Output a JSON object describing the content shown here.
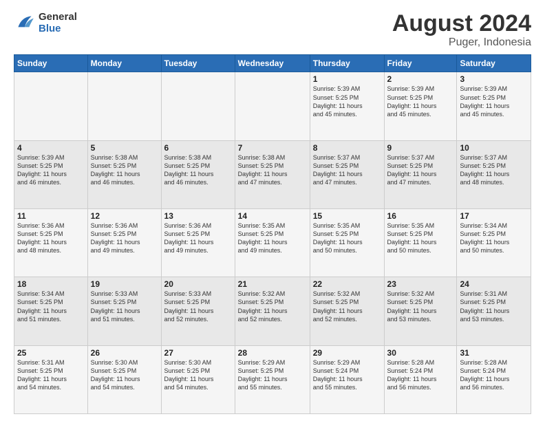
{
  "logo": {
    "line1": "General",
    "line2": "Blue"
  },
  "title": "August 2024",
  "subtitle": "Puger, Indonesia",
  "days_header": [
    "Sunday",
    "Monday",
    "Tuesday",
    "Wednesday",
    "Thursday",
    "Friday",
    "Saturday"
  ],
  "weeks": [
    [
      {
        "day": "",
        "info": ""
      },
      {
        "day": "",
        "info": ""
      },
      {
        "day": "",
        "info": ""
      },
      {
        "day": "",
        "info": ""
      },
      {
        "day": "1",
        "info": "Sunrise: 5:39 AM\nSunset: 5:25 PM\nDaylight: 11 hours\nand 45 minutes."
      },
      {
        "day": "2",
        "info": "Sunrise: 5:39 AM\nSunset: 5:25 PM\nDaylight: 11 hours\nand 45 minutes."
      },
      {
        "day": "3",
        "info": "Sunrise: 5:39 AM\nSunset: 5:25 PM\nDaylight: 11 hours\nand 45 minutes."
      }
    ],
    [
      {
        "day": "4",
        "info": "Sunrise: 5:39 AM\nSunset: 5:25 PM\nDaylight: 11 hours\nand 46 minutes."
      },
      {
        "day": "5",
        "info": "Sunrise: 5:38 AM\nSunset: 5:25 PM\nDaylight: 11 hours\nand 46 minutes."
      },
      {
        "day": "6",
        "info": "Sunrise: 5:38 AM\nSunset: 5:25 PM\nDaylight: 11 hours\nand 46 minutes."
      },
      {
        "day": "7",
        "info": "Sunrise: 5:38 AM\nSunset: 5:25 PM\nDaylight: 11 hours\nand 47 minutes."
      },
      {
        "day": "8",
        "info": "Sunrise: 5:37 AM\nSunset: 5:25 PM\nDaylight: 11 hours\nand 47 minutes."
      },
      {
        "day": "9",
        "info": "Sunrise: 5:37 AM\nSunset: 5:25 PM\nDaylight: 11 hours\nand 47 minutes."
      },
      {
        "day": "10",
        "info": "Sunrise: 5:37 AM\nSunset: 5:25 PM\nDaylight: 11 hours\nand 48 minutes."
      }
    ],
    [
      {
        "day": "11",
        "info": "Sunrise: 5:36 AM\nSunset: 5:25 PM\nDaylight: 11 hours\nand 48 minutes."
      },
      {
        "day": "12",
        "info": "Sunrise: 5:36 AM\nSunset: 5:25 PM\nDaylight: 11 hours\nand 49 minutes."
      },
      {
        "day": "13",
        "info": "Sunrise: 5:36 AM\nSunset: 5:25 PM\nDaylight: 11 hours\nand 49 minutes."
      },
      {
        "day": "14",
        "info": "Sunrise: 5:35 AM\nSunset: 5:25 PM\nDaylight: 11 hours\nand 49 minutes."
      },
      {
        "day": "15",
        "info": "Sunrise: 5:35 AM\nSunset: 5:25 PM\nDaylight: 11 hours\nand 50 minutes."
      },
      {
        "day": "16",
        "info": "Sunrise: 5:35 AM\nSunset: 5:25 PM\nDaylight: 11 hours\nand 50 minutes."
      },
      {
        "day": "17",
        "info": "Sunrise: 5:34 AM\nSunset: 5:25 PM\nDaylight: 11 hours\nand 50 minutes."
      }
    ],
    [
      {
        "day": "18",
        "info": "Sunrise: 5:34 AM\nSunset: 5:25 PM\nDaylight: 11 hours\nand 51 minutes."
      },
      {
        "day": "19",
        "info": "Sunrise: 5:33 AM\nSunset: 5:25 PM\nDaylight: 11 hours\nand 51 minutes."
      },
      {
        "day": "20",
        "info": "Sunrise: 5:33 AM\nSunset: 5:25 PM\nDaylight: 11 hours\nand 52 minutes."
      },
      {
        "day": "21",
        "info": "Sunrise: 5:32 AM\nSunset: 5:25 PM\nDaylight: 11 hours\nand 52 minutes."
      },
      {
        "day": "22",
        "info": "Sunrise: 5:32 AM\nSunset: 5:25 PM\nDaylight: 11 hours\nand 52 minutes."
      },
      {
        "day": "23",
        "info": "Sunrise: 5:32 AM\nSunset: 5:25 PM\nDaylight: 11 hours\nand 53 minutes."
      },
      {
        "day": "24",
        "info": "Sunrise: 5:31 AM\nSunset: 5:25 PM\nDaylight: 11 hours\nand 53 minutes."
      }
    ],
    [
      {
        "day": "25",
        "info": "Sunrise: 5:31 AM\nSunset: 5:25 PM\nDaylight: 11 hours\nand 54 minutes."
      },
      {
        "day": "26",
        "info": "Sunrise: 5:30 AM\nSunset: 5:25 PM\nDaylight: 11 hours\nand 54 minutes."
      },
      {
        "day": "27",
        "info": "Sunrise: 5:30 AM\nSunset: 5:25 PM\nDaylight: 11 hours\nand 54 minutes."
      },
      {
        "day": "28",
        "info": "Sunrise: 5:29 AM\nSunset: 5:25 PM\nDaylight: 11 hours\nand 55 minutes."
      },
      {
        "day": "29",
        "info": "Sunrise: 5:29 AM\nSunset: 5:24 PM\nDaylight: 11 hours\nand 55 minutes."
      },
      {
        "day": "30",
        "info": "Sunrise: 5:28 AM\nSunset: 5:24 PM\nDaylight: 11 hours\nand 56 minutes."
      },
      {
        "day": "31",
        "info": "Sunrise: 5:28 AM\nSunset: 5:24 PM\nDaylight: 11 hours\nand 56 minutes."
      }
    ]
  ]
}
